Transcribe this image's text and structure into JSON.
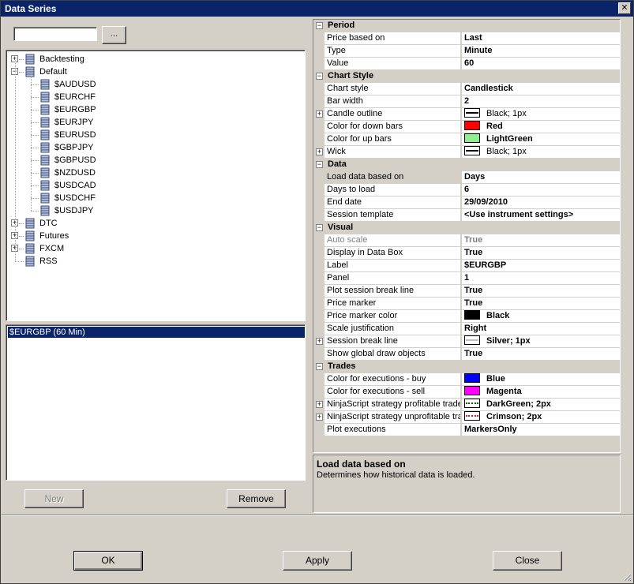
{
  "window": {
    "title": "Data Series",
    "close_glyph": "✕"
  },
  "search": {
    "value": "",
    "browse_label": "..."
  },
  "tree": {
    "roots": [
      {
        "label": "Backtesting",
        "expanded": false
      },
      {
        "label": "Default",
        "expanded": true,
        "children": [
          "$AUDUSD",
          "$EURCHF",
          "$EURGBP",
          "$EURJPY",
          "$EURUSD",
          "$GBPJPY",
          "$GBPUSD",
          "$NZDUSD",
          "$USDCAD",
          "$USDCHF",
          "$USDJPY"
        ]
      },
      {
        "label": "DTC",
        "expanded": false
      },
      {
        "label": "Futures",
        "expanded": false
      },
      {
        "label": "FXCM",
        "expanded": false
      },
      {
        "label": "RSS",
        "expanded": null
      }
    ]
  },
  "series_list": {
    "items": [
      "$EURGBP (60 Min)"
    ]
  },
  "left_buttons": {
    "new": "New",
    "remove": "Remove"
  },
  "grid": [
    {
      "category": "Period",
      "rows": [
        {
          "name": "Price based on",
          "value": "Last"
        },
        {
          "name": "Type",
          "value": "Minute"
        },
        {
          "name": "Value",
          "value": "60"
        }
      ]
    },
    {
      "category": "Chart Style",
      "rows": [
        {
          "name": "Chart style",
          "value": "Candlestick"
        },
        {
          "name": "Bar width",
          "value": "2"
        },
        {
          "name": "Candle outline",
          "value": "Black; 1px",
          "expandable": true,
          "line": "#000000",
          "normal": true
        },
        {
          "name": "Color for down bars",
          "value": "Red",
          "swatch": "#ff0000"
        },
        {
          "name": "Color for up bars",
          "value": "LightGreen",
          "swatch": "#90ee90"
        },
        {
          "name": "Wick",
          "value": "Black; 1px",
          "expandable": true,
          "line": "#000000",
          "normal": true
        }
      ]
    },
    {
      "category": "Data",
      "rows": [
        {
          "name": "Load data based on",
          "value": "Days",
          "selected": true
        },
        {
          "name": "Days to load",
          "value": "6"
        },
        {
          "name": "End date",
          "value": "29/09/2010"
        },
        {
          "name": "Session template",
          "value": "<Use instrument settings>"
        }
      ]
    },
    {
      "category": "Visual",
      "rows": [
        {
          "name": "Auto scale",
          "value": "True",
          "disabled": true
        },
        {
          "name": "Display in Data Box",
          "value": "True"
        },
        {
          "name": "Label",
          "value": "$EURGBP"
        },
        {
          "name": "Panel",
          "value": "1"
        },
        {
          "name": "Plot session break line",
          "value": "True"
        },
        {
          "name": "Price marker",
          "value": "True"
        },
        {
          "name": "Price marker color",
          "value": "Black",
          "swatch": "#000000"
        },
        {
          "name": "Scale justification",
          "value": "Right"
        },
        {
          "name": "Session break line",
          "value": "Silver; 1px",
          "expandable": true,
          "line": "#c0c0c0"
        },
        {
          "name": "Show global draw objects",
          "value": "True"
        }
      ]
    },
    {
      "category": "Trades",
      "rows": [
        {
          "name": "Color for executions - buy",
          "value": "Blue",
          "swatch": "#0000ff"
        },
        {
          "name": "Color for executions - sell",
          "value": "Magenta",
          "swatch": "#ff00ff"
        },
        {
          "name": "NinjaScript strategy profitable trades",
          "value": "DarkGreen; 2px",
          "expandable": true,
          "line": "#006400",
          "dotted": true
        },
        {
          "name": "NinjaScript strategy unprofitable trades",
          "value": "Crimson; 2px",
          "expandable": true,
          "line": "#dc143c",
          "dotted": true
        },
        {
          "name": "Plot executions",
          "value": "MarkersOnly"
        }
      ]
    }
  ],
  "help": {
    "title": "Load data based on",
    "description": "Determines how historical data is loaded."
  },
  "dialog_buttons": {
    "ok": "OK",
    "apply": "Apply",
    "close": "Close"
  },
  "glyphs": {
    "collapse": "−",
    "expand": "+"
  },
  "colors": {
    "selection": "#0a246a",
    "titlebar": "#0a246a",
    "face": "#d4d0c8"
  }
}
